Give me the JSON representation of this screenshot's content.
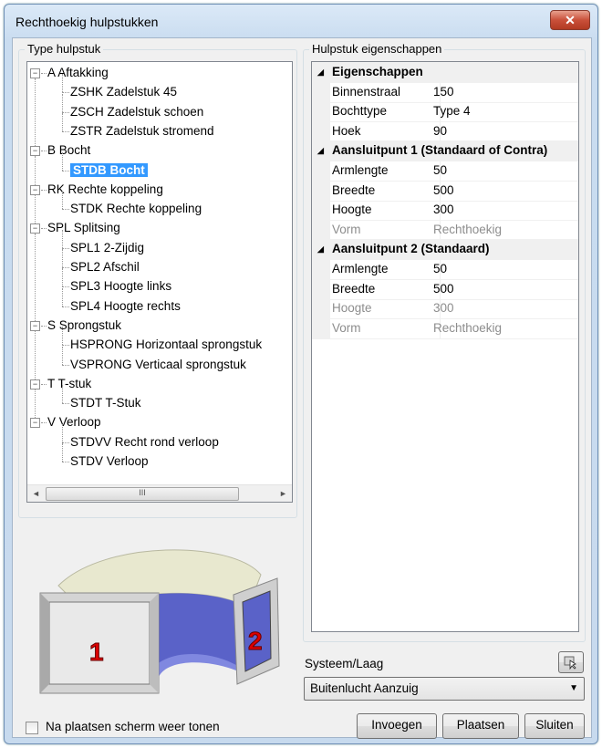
{
  "window": {
    "title": "Rechthoekig hulpstukken",
    "close_glyph": "✕"
  },
  "tree_panel": {
    "legend": "Type hulpstuk",
    "items": [
      {
        "label": "A Aftakking",
        "level": 0,
        "expander": "−"
      },
      {
        "label": "ZSHK Zadelstuk 45",
        "level": 1
      },
      {
        "label": "ZSCH Zadelstuk schoen",
        "level": 1
      },
      {
        "label": "ZSTR Zadelstuk stromend",
        "level": 1
      },
      {
        "label": "B Bocht",
        "level": 0,
        "expander": "−"
      },
      {
        "label": "STDB Bocht",
        "level": 1,
        "selected": true
      },
      {
        "label": "RK Rechte koppeling",
        "level": 0,
        "expander": "−"
      },
      {
        "label": "STDK Rechte koppeling",
        "level": 1
      },
      {
        "label": "SPL Splitsing",
        "level": 0,
        "expander": "−"
      },
      {
        "label": "SPL1 2-Zijdig",
        "level": 1
      },
      {
        "label": "SPL2 Afschil",
        "level": 1
      },
      {
        "label": "SPL3 Hoogte links",
        "level": 1
      },
      {
        "label": "SPL4 Hoogte rechts",
        "level": 1
      },
      {
        "label": "S Sprongstuk",
        "level": 0,
        "expander": "−"
      },
      {
        "label": "HSPRONG Horizontaal sprongstuk",
        "level": 1
      },
      {
        "label": "VSPRONG Verticaal sprongstuk",
        "level": 1
      },
      {
        "label": "T T-stuk",
        "level": 0,
        "expander": "−"
      },
      {
        "label": "STDT T-Stuk",
        "level": 1
      },
      {
        "label": "V Verloop",
        "level": 0,
        "expander": "−"
      },
      {
        "label": "STDVV Recht rond verloop",
        "level": 1
      },
      {
        "label": "STDV Verloop",
        "level": 1
      }
    ],
    "scroll_left": "◄",
    "scroll_right": "►",
    "scroll_thumb": "III"
  },
  "preview": {
    "label_1": "1",
    "label_2": "2"
  },
  "props_panel": {
    "legend": "Hulpstuk eigenschappen",
    "rows": [
      {
        "type": "category",
        "label": "Eigenschappen"
      },
      {
        "type": "prop",
        "name": "Binnenstraal",
        "value": "150"
      },
      {
        "type": "prop",
        "name": "Bochttype",
        "value": "Type 4"
      },
      {
        "type": "prop",
        "name": "Hoek",
        "value": "90"
      },
      {
        "type": "category",
        "label": "Aansluitpunt 1 (Standaard of Contra)"
      },
      {
        "type": "prop",
        "name": "Armlengte",
        "value": "50"
      },
      {
        "type": "prop",
        "name": "Breedte",
        "value": "500"
      },
      {
        "type": "prop",
        "name": "Hoogte",
        "value": "300"
      },
      {
        "type": "prop",
        "name": "Vorm",
        "value": "Rechthoekig",
        "disabled": true
      },
      {
        "type": "category",
        "label": "Aansluitpunt 2 (Standaard)"
      },
      {
        "type": "prop",
        "name": "Armlengte",
        "value": "50"
      },
      {
        "type": "prop",
        "name": "Breedte",
        "value": "500"
      },
      {
        "type": "prop",
        "name": "Hoogte",
        "value": "300",
        "disabled": true
      },
      {
        "type": "prop",
        "name": "Vorm",
        "value": "Rechthoekig",
        "disabled": true
      }
    ],
    "category_glyph": "◢"
  },
  "system": {
    "label": "Systeem/Laag",
    "selected": "Buitenlucht Aanzuig",
    "dropdown_glyph": "▼"
  },
  "checkbox": {
    "label": "Na plaatsen scherm weer tonen",
    "checked": false
  },
  "buttons": {
    "insert": "Invoegen",
    "place": "Plaatsen",
    "close": "Sluiten"
  },
  "colors": {
    "selection": "#3399ff",
    "duct_face": "#5a62c8",
    "flange": "#c8c8c8",
    "label_red": "#dd0000"
  }
}
